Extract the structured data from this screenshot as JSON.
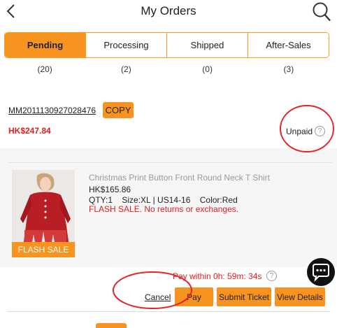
{
  "header": {
    "title": "My Orders"
  },
  "tabs": [
    {
      "label": "Pending",
      "count": "(20)",
      "active": true
    },
    {
      "label": "Processing",
      "count": "(2)"
    },
    {
      "label": "Shipped",
      "count": "(0)"
    },
    {
      "label": "After-Sales",
      "count": "(3)"
    }
  ],
  "order": {
    "number": "MM2011130927028476",
    "copy_label": "COPY",
    "total": "HK$247.84",
    "status": "Unpaid",
    "help_glyph": "?"
  },
  "product": {
    "badge": "FLASH SALE",
    "name": "Christmas Print Button Front Round Neck T Shirt",
    "price": "HK$165.86",
    "spec": "QTY:1    Size:XL | US14-16    Color:Red",
    "note": "FLASH SALE. No returns or exchanges."
  },
  "payment": {
    "countdown": "Pay within 0h: 59m: 34s"
  },
  "actions": {
    "cancel": "Cancel",
    "pay": "Pay",
    "submit_ticket": "Submit Ticket",
    "view_details": "View Details"
  },
  "colors": {
    "accent": "#f7931e",
    "price_red": "#e02020",
    "annotation_red": "#e4242a"
  }
}
